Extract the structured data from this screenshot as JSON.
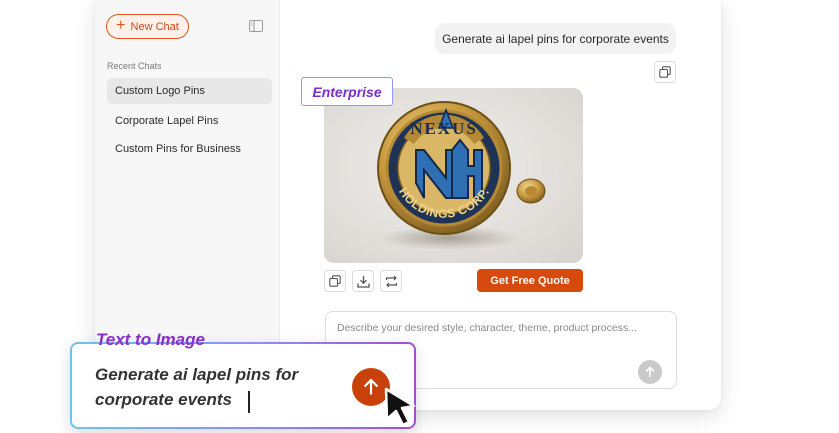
{
  "sidebar": {
    "new_chat_label": "New Chat",
    "recent_label": "Recent Chats",
    "items": [
      {
        "label": "Custom Logo Pins",
        "active": true
      },
      {
        "label": "Corporate Lapel Pins",
        "active": false
      },
      {
        "label": "Custom Pins for Business",
        "active": false
      }
    ]
  },
  "chat": {
    "user_message": "Generate ai lapel pins for corporate events",
    "badge": "Enterprise",
    "image": {
      "top_text": "NEXUS",
      "bottom_text": "HOLDINGS CORP.",
      "monogram": "NH"
    },
    "quote_button": "Get Free Quote",
    "input_placeholder": "Describe your desired style, character, theme, product process..."
  },
  "overlay": {
    "label": "Text to Image",
    "prompt": "Generate ai lapel pins for corporate events"
  },
  "icons": {
    "copy": "copy-icon",
    "download": "download-icon",
    "regenerate": "repeat-icon",
    "send": "arrow-up-icon",
    "panel": "sidebar-toggle-icon"
  },
  "colors": {
    "accent": "#d64a0d",
    "badge_text": "#7a2fc7",
    "overlay_label": "#8a2dc9"
  }
}
